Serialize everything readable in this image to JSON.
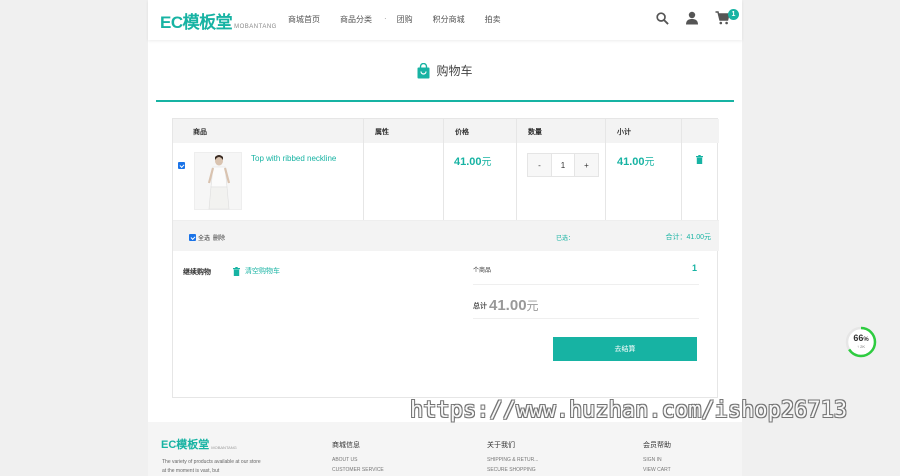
{
  "header": {
    "logo_main": "EC模板堂",
    "logo_sub": "MOBANTANG",
    "nav": [
      "商城首页",
      "商品分类",
      "团购",
      "积分商城",
      "拍卖"
    ],
    "nav_dot": "·",
    "cart_count": "1"
  },
  "title": "购物车",
  "table": {
    "headers": [
      "商品",
      "属性",
      "价格",
      "数量",
      "小计"
    ]
  },
  "item": {
    "name": "Top with ribbed neckline",
    "price": "41.00",
    "currency": "元",
    "quantity": "1",
    "minus": "-",
    "plus": "+",
    "subtotal": "41.00"
  },
  "footbar": {
    "select_all": "全选",
    "delete": "删除",
    "selected": "已选：",
    "total": "合计：41.00元"
  },
  "actions": {
    "continue": "继续购物",
    "clear": "清空购物车"
  },
  "summary": {
    "count_label": "个商品",
    "count": "1",
    "total_label": "总计",
    "total": "41.00",
    "currency": "元",
    "checkout": "去结算"
  },
  "footer": {
    "logo_main": "EC模板堂",
    "logo_sub": "MOBANTANG",
    "desc": "The variety of products available at our store at the moment is vast, but",
    "col1_title": "商城信息",
    "col1_items": [
      "ABOUT US",
      "CUSTOMER SERVICE"
    ],
    "col2_title": "关于我们",
    "col2_items": [
      "SHIPPING & RETUR...",
      "SECURE SHOPPING"
    ],
    "col3_title": "会员帮助",
    "col3_items": [
      "SIGN IN",
      "VIEW CART"
    ]
  },
  "float_widget": {
    "percent": "66",
    "unit": "%",
    "sub": "↑ 2K"
  },
  "watermark": "https://www.huzhan.com/ishop26713",
  "colors": {
    "accent": "#17b3a3",
    "checkbox": "#1a73e8"
  }
}
